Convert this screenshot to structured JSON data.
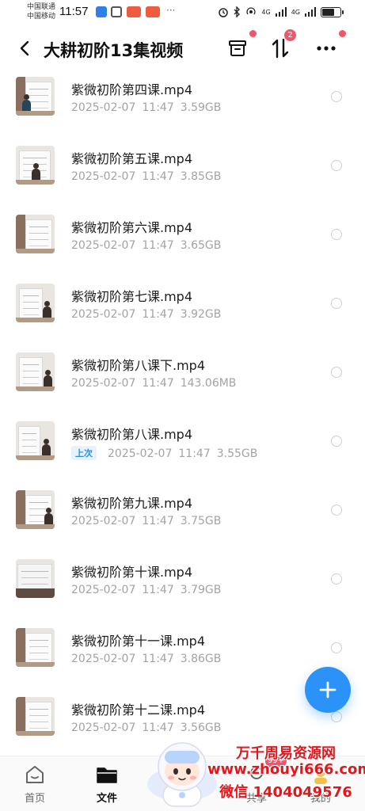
{
  "status_bar": {
    "carrier_1": "中国联通",
    "carrier_2": "中国移动",
    "time": "11:57",
    "signal_1": "4G",
    "signal_2": "4G"
  },
  "header": {
    "title": "大耕初阶13集视频",
    "sort_badge": "2"
  },
  "files": [
    {
      "name": "紫微初阶第四课.mp4",
      "date": "2025-02-07",
      "time": "11:47",
      "size": "3.59GB"
    },
    {
      "name": "紫微初阶第五课.mp4",
      "date": "2025-02-07",
      "time": "11:47",
      "size": "3.85GB"
    },
    {
      "name": "紫微初阶第六课.mp4",
      "date": "2025-02-07",
      "time": "11:47",
      "size": "3.65GB"
    },
    {
      "name": "紫微初阶第七课.mp4",
      "date": "2025-02-07",
      "time": "11:47",
      "size": "3.92GB"
    },
    {
      "name": "紫微初阶第八课下.mp4",
      "date": "2025-02-07",
      "time": "11:47",
      "size": "143.06MB"
    },
    {
      "name": "紫微初阶第八课.mp4",
      "tag": "上次",
      "date": "2025-02-07",
      "time": "11:47",
      "size": "3.55GB"
    },
    {
      "name": "紫微初阶第九课.mp4",
      "date": "2025-02-07",
      "time": "11:47",
      "size": "3.75GB"
    },
    {
      "name": "紫微初阶第十课.mp4",
      "date": "2025-02-07",
      "time": "11:47",
      "size": "3.79GB"
    },
    {
      "name": "紫微初阶第十一课.mp4",
      "date": "2025-02-07",
      "time": "11:47",
      "size": "3.86GB"
    },
    {
      "name": "紫微初阶第十二课.mp4",
      "date": "2025-02-07",
      "time": "11:47",
      "size": "3.56GB"
    }
  ],
  "bottom_nav": {
    "home": "首页",
    "files": "文件",
    "share": "共享",
    "mine": "我的",
    "share_badge": "99+"
  },
  "watermark": {
    "line1": "万千周易资源网",
    "line2": "www.zhouyi666.com",
    "line3": "微信 1404049576"
  },
  "colors": {
    "accent": "#2b92f7",
    "badge": "#f0566b",
    "meta_text": "#a3a3a3",
    "last_tag": "#2e8be0",
    "watermark": "#e3171b"
  }
}
